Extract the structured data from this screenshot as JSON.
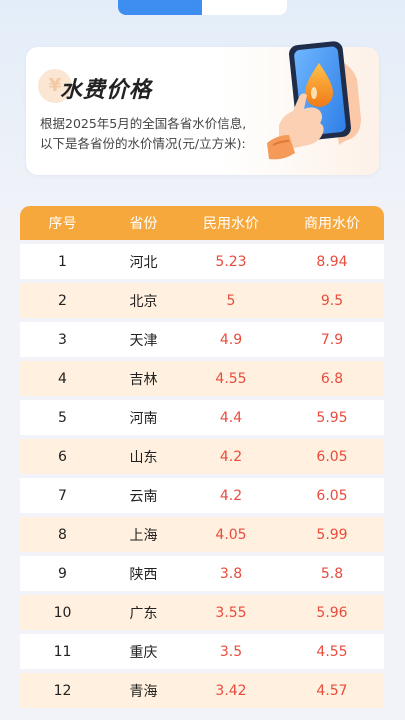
{
  "card": {
    "title": "水费价格",
    "title_deco": "¥",
    "desc_line1": "根据2025年5月的全国各省水价信息,",
    "desc_line2": "以下是各省份的水价情况(元/立方米):"
  },
  "table": {
    "headers": [
      "序号",
      "省份",
      "民用水价",
      "商用水价"
    ],
    "rows": [
      [
        "1",
        "河北",
        "5.23",
        "8.94"
      ],
      [
        "2",
        "北京",
        "5",
        "9.5"
      ],
      [
        "3",
        "天津",
        "4.9",
        "7.9"
      ],
      [
        "4",
        "吉林",
        "4.55",
        "6.8"
      ],
      [
        "5",
        "河南",
        "4.4",
        "5.95"
      ],
      [
        "6",
        "山东",
        "4.2",
        "6.05"
      ],
      [
        "7",
        "云南",
        "4.2",
        "6.05"
      ],
      [
        "8",
        "上海",
        "4.05",
        "5.99"
      ],
      [
        "9",
        "陕西",
        "3.8",
        "5.8"
      ],
      [
        "10",
        "广东",
        "3.55",
        "5.96"
      ],
      [
        "11",
        "重庆",
        "3.5",
        "4.55"
      ],
      [
        "12",
        "青海",
        "3.42",
        "4.57"
      ]
    ]
  },
  "colors": {
    "accent": "#f7a83d",
    "price": "#e84c3d",
    "row_alt": "#fff0df",
    "tab_active": "#3d8ef0"
  }
}
